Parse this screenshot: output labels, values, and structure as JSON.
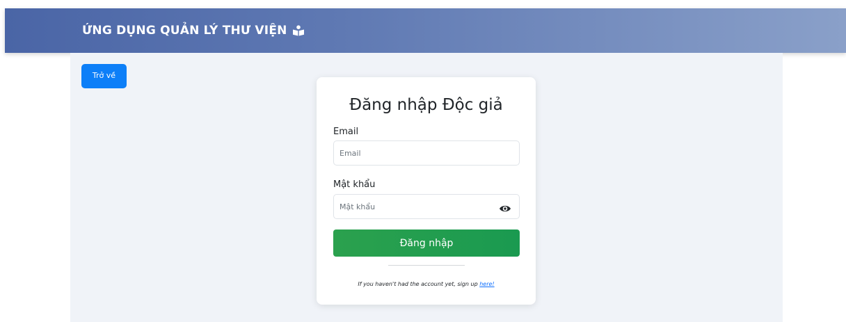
{
  "header": {
    "title": "ỨNG DỤNG QUẢN LÝ THƯ VIỆN",
    "icon": "book-reader-icon"
  },
  "nav": {
    "back_label": "Trở về"
  },
  "login_form": {
    "title": "Đăng nhập Độc giả",
    "email_label": "Email",
    "email_value": "",
    "email_placeholder": "Email",
    "password_label": "Mật khẩu",
    "password_value": "",
    "password_placeholder": "Mật khẩu",
    "password_toggle_icon": "eye-icon",
    "submit_label": "Đăng nhập",
    "signup_prompt": "If you haven't had the account yet, sign up ",
    "signup_link": "here!"
  },
  "colors": {
    "header_start": "#4a65a6",
    "header_end": "#8aa0c9",
    "primary": "#0d7ff8",
    "success": "#2ba14e",
    "link": "#0d6efd",
    "page_bg": "#f0f3f8"
  }
}
